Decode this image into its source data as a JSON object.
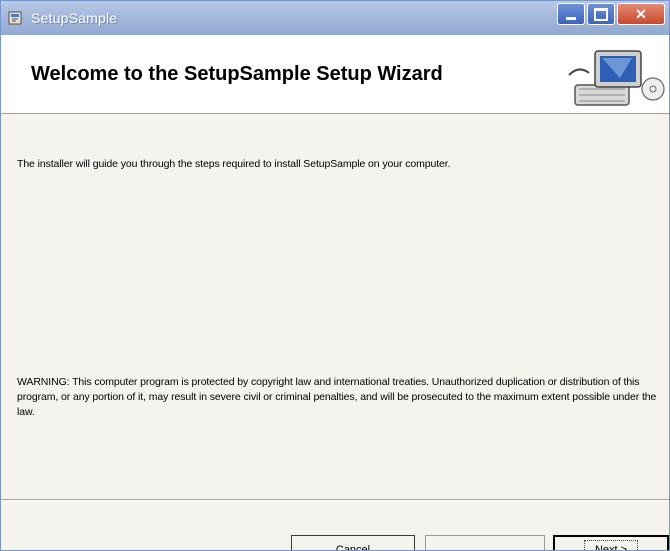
{
  "window": {
    "title": "SetupSample",
    "icons": {
      "app": "installer-icon",
      "minimize": "minimize-icon",
      "maximize": "maximize-icon",
      "close": "close-icon"
    }
  },
  "banner": {
    "title": "Welcome to the SetupSample Setup Wizard",
    "art": "computer-setup-icon"
  },
  "content": {
    "intro": "The installer will guide you through the steps required to install SetupSample on your computer.",
    "warning": "WARNING: This computer program is protected by copyright law and international treaties. Unauthorized duplication or distribution of this program, or any portion of it, may result in severe civil or criminal penalties, and will be prosecuted to the maximum extent possible under the law."
  },
  "buttons": {
    "cancel": "Cancel",
    "back": "",
    "next": "Next >"
  }
}
